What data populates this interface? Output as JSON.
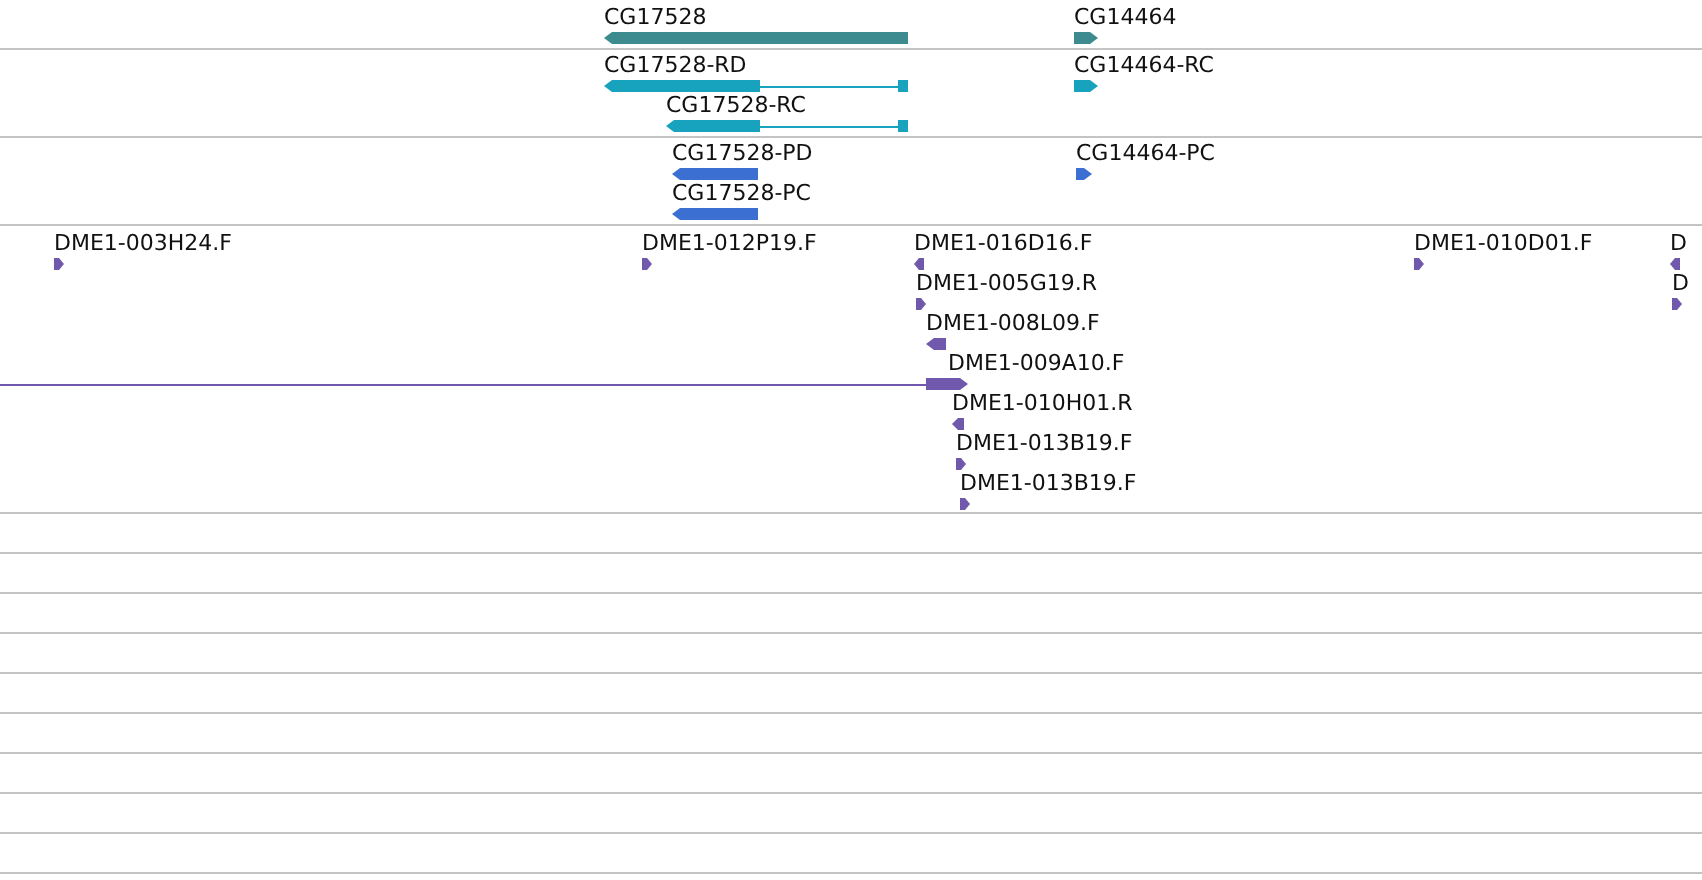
{
  "tracks": [
    {
      "kind": "gene",
      "features": [
        {
          "label": "CG17528",
          "reverse": true
        },
        {
          "label": "CG14464",
          "reverse": false
        }
      ]
    },
    {
      "kind": "transcript",
      "features": [
        {
          "label": "CG17528-RD",
          "reverse": true
        },
        {
          "label": "CG17528-RC",
          "reverse": true
        },
        {
          "label": "CG14464-RC",
          "reverse": false
        }
      ]
    },
    {
      "kind": "protein",
      "features": [
        {
          "label": "CG17528-PD",
          "reverse": true
        },
        {
          "label": "CG17528-PC",
          "reverse": true
        },
        {
          "label": "CG14464-PC",
          "reverse": false
        }
      ]
    },
    {
      "kind": "clone",
      "features": [
        {
          "label": "DME1-003H24.F",
          "reverse": false
        },
        {
          "label": "DME1-012P19.F",
          "reverse": false
        },
        {
          "label": "DME1-016D16.F",
          "reverse": true
        },
        {
          "label": "DME1-010D01.F",
          "reverse": false
        },
        {
          "label": "D",
          "reverse": true
        },
        {
          "label": "DME1-005G19.R",
          "reverse": false
        },
        {
          "label": "D",
          "reverse": false
        },
        {
          "label": "DME1-008L09.F",
          "reverse": true
        },
        {
          "label": "DME1-009A10.F",
          "reverse": false
        },
        {
          "label": "DME1-010H01.R",
          "reverse": true
        },
        {
          "label": "DME1-013B19.F",
          "reverse": false
        },
        {
          "label": "DME1-013B19.F",
          "reverse": false
        }
      ]
    }
  ]
}
